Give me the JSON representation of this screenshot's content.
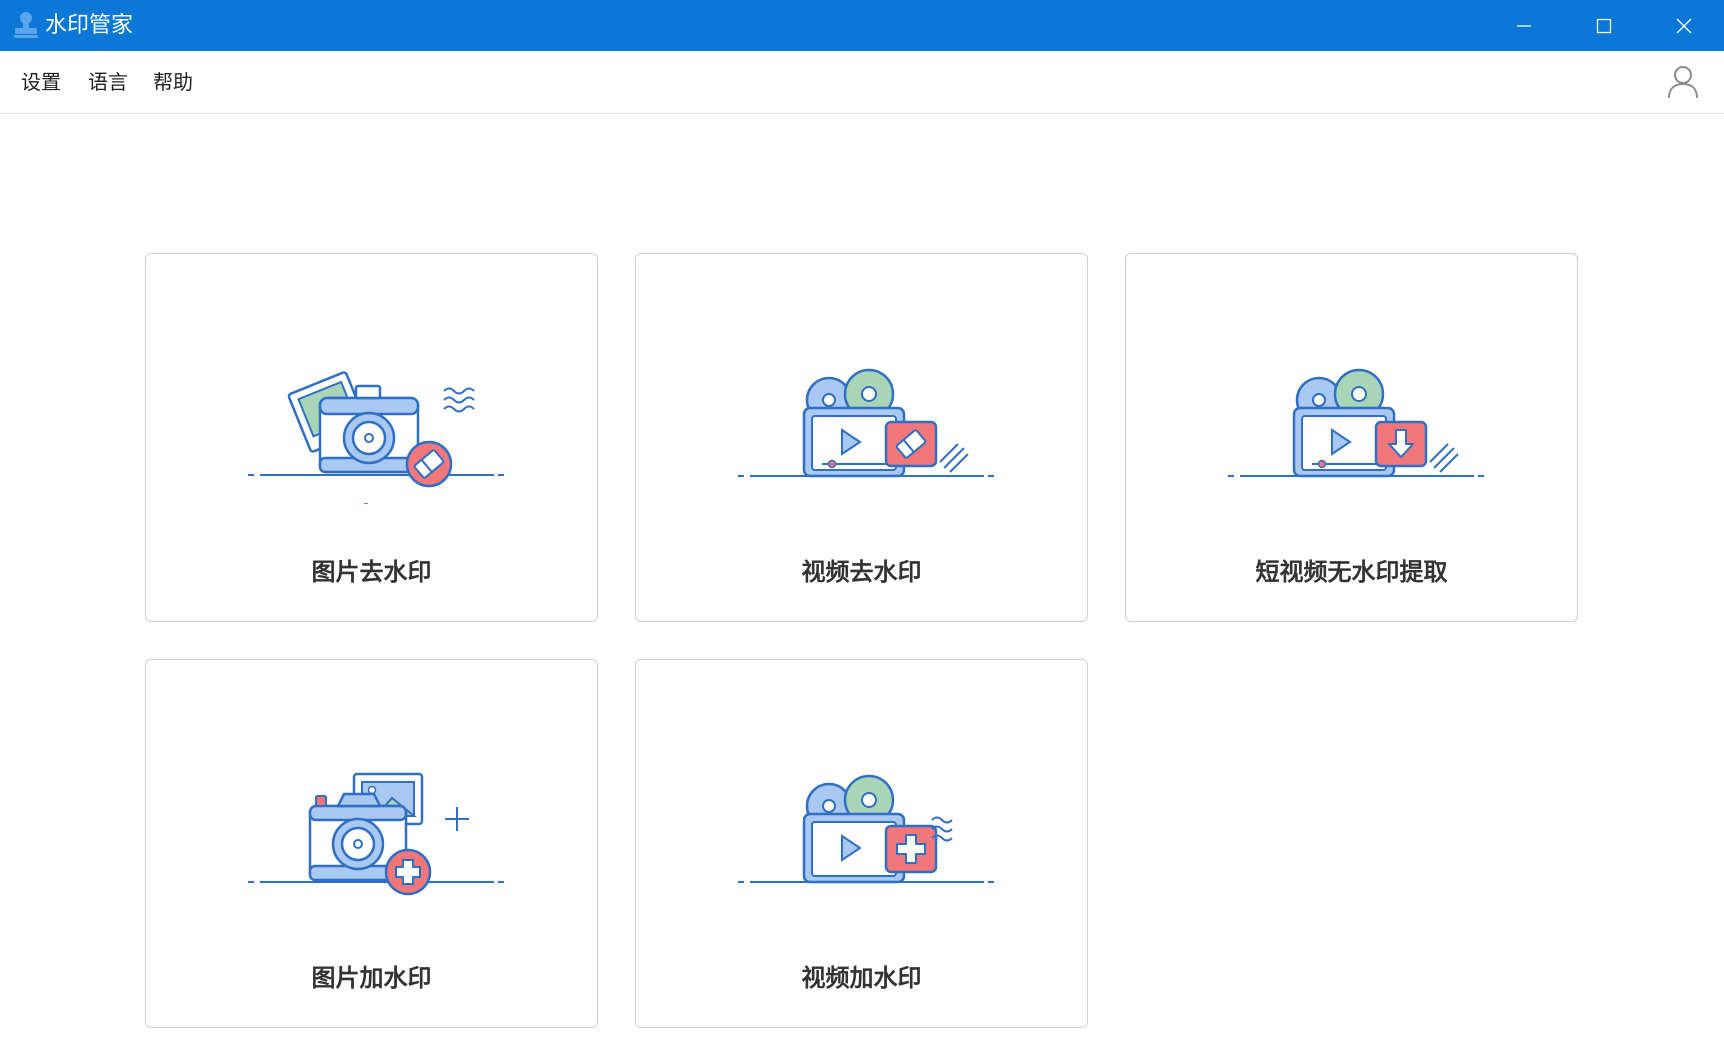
{
  "app": {
    "title": "水印管家"
  },
  "window_controls": {
    "minimize": "minimize-icon",
    "maximize": "maximize-icon",
    "close": "close-icon"
  },
  "menu": {
    "settings": "设置",
    "language": "语言",
    "help": "帮助"
  },
  "cards": [
    {
      "label": "图片去水印",
      "icon": "camera-eraser-icon"
    },
    {
      "label": "视频去水印",
      "icon": "video-eraser-icon"
    },
    {
      "label": "短视频无水印提取",
      "icon": "video-download-icon"
    },
    {
      "label": "图片加水印",
      "icon": "camera-add-icon"
    },
    {
      "label": "视频加水印",
      "icon": "video-add-icon"
    }
  ],
  "colors": {
    "titlebar": "#0b78d8",
    "line_blue": "#2f6fc6",
    "fill_blue": "#a9c8f2",
    "fill_green": "#a8d5b7",
    "accent_red": "#f2777a",
    "card_border": "#cfcfcf"
  }
}
